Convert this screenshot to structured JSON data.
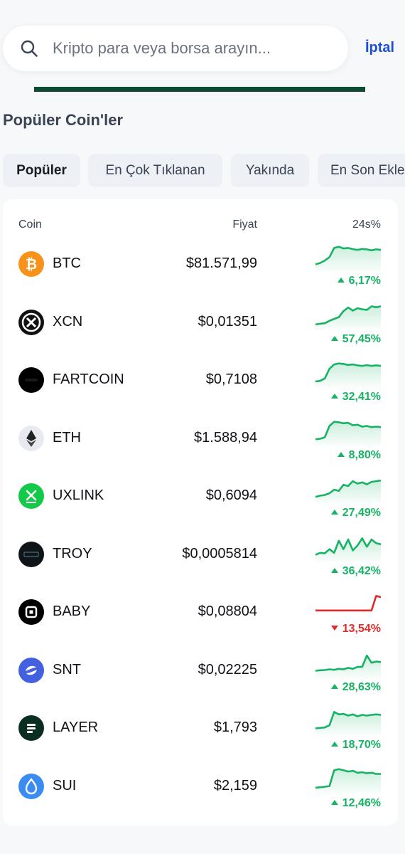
{
  "search": {
    "placeholder": "Kripto para veya borsa arayın...",
    "value": "",
    "cancel_label": "İptal"
  },
  "section_title": "Popüler Coin'ler",
  "tabs": [
    {
      "label": "Popüler",
      "active": true
    },
    {
      "label": "En Çok Tıklanan",
      "active": false
    },
    {
      "label": "Yakında",
      "active": false
    },
    {
      "label": "En Son Ekle",
      "active": false
    }
  ],
  "table": {
    "headers": {
      "coin": "Coin",
      "price": "Fiyat",
      "change": "24s%"
    },
    "rows": [
      {
        "symbol": "BTC",
        "price": "$81.571,99",
        "change": "6,17%",
        "direction": "up",
        "icon": "bitcoin-icon",
        "icon_color": "#f7931a",
        "trend": [
          0.78,
          0.72,
          0.62,
          0.48,
          0.1,
          0.05,
          0.12,
          0.1,
          0.15,
          0.18,
          0.14,
          0.16,
          0.2,
          0.16,
          0.18
        ]
      },
      {
        "symbol": "XCN",
        "price": "$0,01351",
        "change": "57,45%",
        "direction": "up",
        "icon": "xcn-icon",
        "icon_color": "#111111",
        "trend": [
          0.85,
          0.82,
          0.8,
          0.7,
          0.62,
          0.55,
          0.3,
          0.15,
          0.28,
          0.18,
          0.22,
          0.25,
          0.1,
          0.14,
          0.1
        ]
      },
      {
        "symbol": "FARTCOIN",
        "price": "$0,7108",
        "change": "32,41%",
        "direction": "up",
        "icon": "fartcoin-icon",
        "icon_color": "#000000",
        "trend": [
          0.82,
          0.8,
          0.7,
          0.3,
          0.12,
          0.08,
          0.1,
          0.14,
          0.12,
          0.16,
          0.18,
          0.15,
          0.18,
          0.16,
          0.18
        ]
      },
      {
        "symbol": "ETH",
        "price": "$1.588,94",
        "change": "8,80%",
        "direction": "up",
        "icon": "ethereum-icon",
        "icon_color": "#e8eaef",
        "trend": [
          0.8,
          0.78,
          0.72,
          0.25,
          0.08,
          0.1,
          0.14,
          0.12,
          0.22,
          0.2,
          0.28,
          0.25,
          0.3,
          0.28,
          0.3
        ]
      },
      {
        "symbol": "UXLINK",
        "price": "$0,6094",
        "change": "27,49%",
        "direction": "up",
        "icon": "uxlink-icon",
        "icon_color": "#12c94a",
        "trend": [
          0.8,
          0.75,
          0.72,
          0.65,
          0.5,
          0.55,
          0.3,
          0.35,
          0.15,
          0.25,
          0.2,
          0.28,
          0.18,
          0.15,
          0.12
        ]
      },
      {
        "symbol": "TROY",
        "price": "$0,0005814",
        "change": "36,42%",
        "direction": "up",
        "icon": "troy-icon",
        "icon_color": "#0f1419",
        "trend": [
          0.78,
          0.7,
          0.72,
          0.55,
          0.7,
          0.2,
          0.55,
          0.15,
          0.6,
          0.4,
          0.1,
          0.45,
          0.15,
          0.3,
          0.35
        ]
      },
      {
        "symbol": "BABY",
        "price": "$0,08804",
        "change": "13,54%",
        "direction": "down",
        "icon": "babylon-icon",
        "icon_color": "#000000",
        "trend": [
          0.7,
          0.7,
          0.7,
          0.7,
          0.7,
          0.7,
          0.7,
          0.7,
          0.7,
          0.7,
          0.7,
          0.7,
          0.7,
          0.1,
          0.15
        ]
      },
      {
        "symbol": "SNT",
        "price": "$0,02225",
        "change": "28,63%",
        "direction": "up",
        "icon": "status-icon",
        "icon_color": "#4360df",
        "trend": [
          0.78,
          0.76,
          0.75,
          0.72,
          0.74,
          0.7,
          0.72,
          0.66,
          0.7,
          0.62,
          0.62,
          0.15,
          0.45,
          0.4,
          0.42
        ]
      },
      {
        "symbol": "LAYER",
        "price": "$1,793",
        "change": "18,70%",
        "direction": "up",
        "icon": "solayer-icon",
        "icon_color": "#0b2e22",
        "trend": [
          0.78,
          0.76,
          0.74,
          0.65,
          0.1,
          0.2,
          0.18,
          0.25,
          0.2,
          0.28,
          0.22,
          0.25,
          0.22,
          0.2,
          0.22
        ]
      },
      {
        "symbol": "SUI",
        "price": "$2,159",
        "change": "12,46%",
        "direction": "up",
        "icon": "sui-icon",
        "icon_color": "#3a8cf0",
        "trend": [
          0.82,
          0.8,
          0.78,
          0.75,
          0.1,
          0.05,
          0.1,
          0.15,
          0.12,
          0.2,
          0.18,
          0.22,
          0.2,
          0.25,
          0.25
        ]
      }
    ]
  },
  "colors": {
    "up": "#16b364",
    "down": "#e12a2a",
    "accent": "#1d4fd8",
    "progress": "#0c4a33"
  }
}
